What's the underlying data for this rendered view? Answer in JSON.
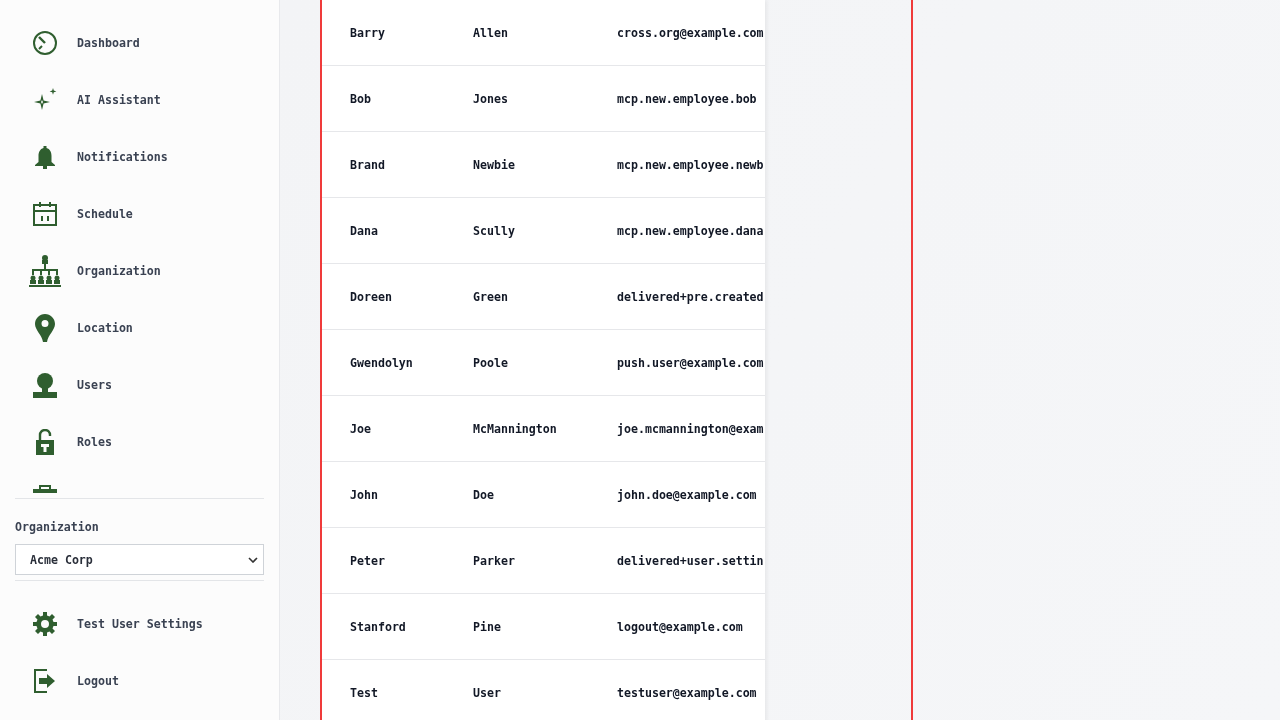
{
  "sidebar": {
    "nav_items": [
      {
        "label": "Dashboard"
      },
      {
        "label": "AI Assistant"
      },
      {
        "label": "Notifications"
      },
      {
        "label": "Schedule"
      },
      {
        "label": "Organization"
      },
      {
        "label": "Location"
      },
      {
        "label": "Users"
      },
      {
        "label": "Roles"
      }
    ],
    "organization": {
      "label": "Organization",
      "value": "Acme Corp"
    },
    "footer_items": [
      {
        "label": "Test User Settings"
      },
      {
        "label": "Logout"
      }
    ]
  },
  "table": {
    "rows": [
      [
        "Barry",
        "Allen",
        "cross.org@example.com"
      ],
      [
        "Bob",
        "Jones",
        "mcp.new.employee.bob"
      ],
      [
        "Brand",
        "Newbie",
        "mcp.new.employee.newb"
      ],
      [
        "Dana",
        "Scully",
        "mcp.new.employee.dana"
      ],
      [
        "Doreen",
        "Green",
        "delivered+pre.created"
      ],
      [
        "Gwendolyn",
        "Poole",
        "push.user@example.com"
      ],
      [
        "Joe",
        "McMannington",
        "joe.mcmannington@exam"
      ],
      [
        "John",
        "Doe",
        "john.doe@example.com"
      ],
      [
        "Peter",
        "Parker",
        "delivered+user.settin"
      ],
      [
        "Stanford",
        "Pine",
        "logout@example.com"
      ],
      [
        "Test",
        "User",
        "testuser@example.com"
      ]
    ]
  }
}
